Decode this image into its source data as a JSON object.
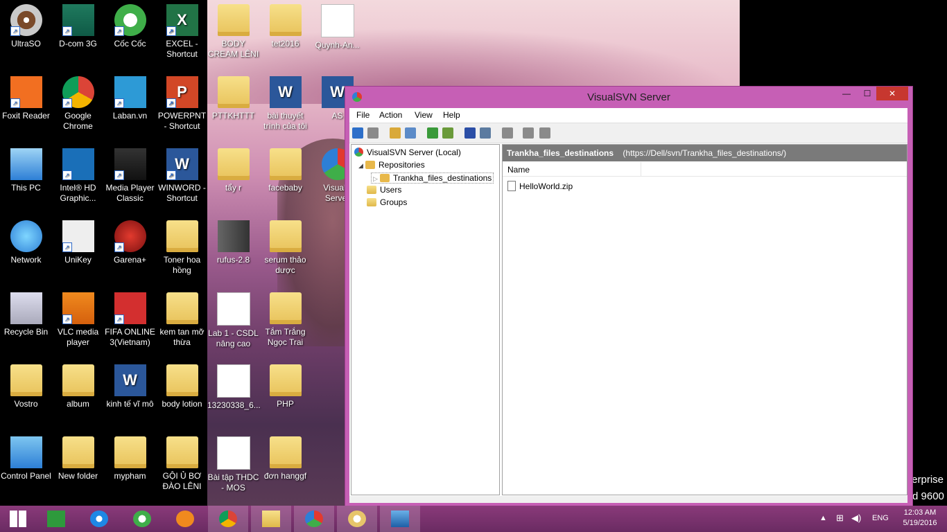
{
  "desktop": {
    "icons": [
      {
        "label": "UltraSO",
        "icon": "ultraiso-icon"
      },
      {
        "label": "D-com 3G",
        "icon": "dcom-3g-icon"
      },
      {
        "label": "Cốc Cốc",
        "icon": "coccoc-icon"
      },
      {
        "label": "EXCEL - Shortcut",
        "icon": "excel-icon"
      },
      {
        "label": "Foxit Reader",
        "icon": "foxit-reader-icon"
      },
      {
        "label": "Google Chrome",
        "icon": "chrome-icon"
      },
      {
        "label": "Laban.vn",
        "icon": "laban-icon"
      },
      {
        "label": "POWERPNT - Shortcut",
        "icon": "powerpoint-icon"
      },
      {
        "label": "This PC",
        "icon": "this-pc-icon"
      },
      {
        "label": "Intel® HD Graphic...",
        "icon": "intel-hd-icon"
      },
      {
        "label": "Media Player Classic",
        "icon": "media-player-classic-icon"
      },
      {
        "label": "WINWORD - Shortcut",
        "icon": "word-icon"
      },
      {
        "label": "Network",
        "icon": "network-icon"
      },
      {
        "label": "UniKey",
        "icon": "unikey-icon"
      },
      {
        "label": "Garena+",
        "icon": "garena-icon"
      },
      {
        "label": "Toner hoa hồng",
        "icon": "folder-icon"
      },
      {
        "label": "Recycle Bin",
        "icon": "recycle-bin-icon"
      },
      {
        "label": "VLC media player",
        "icon": "vlc-icon"
      },
      {
        "label": "FIFA ONLINE 3(Vietnam)",
        "icon": "fifa-online-icon"
      },
      {
        "label": "kem tan mỡ thừa",
        "icon": "folder-icon"
      },
      {
        "label": "Vostro",
        "icon": "user-folder-icon"
      },
      {
        "label": "album",
        "icon": "folder-icon"
      },
      {
        "label": "kinh tế vĩ mô",
        "icon": "word-doc-icon"
      },
      {
        "label": "body lotion",
        "icon": "folder-icon"
      },
      {
        "label": "Control Panel",
        "icon": "control-panel-icon"
      },
      {
        "label": "New folder",
        "icon": "folder-icon"
      },
      {
        "label": "mypham",
        "icon": "folder-icon"
      },
      {
        "label": "GỘI Ủ BƠ ĐÀO LÊNI",
        "icon": "folder-icon"
      },
      {
        "label": "BODY CREAM LÊNI",
        "icon": "folder-icon"
      },
      {
        "label": "tet2016",
        "icon": "folder-icon"
      },
      {
        "label": "Quynh-An...",
        "icon": "photo-icon"
      },
      {
        "label": "PTTKHTTT",
        "icon": "folder-icon"
      },
      {
        "label": "bài thuyết trình của tôi",
        "icon": "word-doc-icon"
      },
      {
        "label": "AS",
        "icon": "word-doc-icon"
      },
      {
        "label": "tẩy r",
        "icon": "folder-icon"
      },
      {
        "label": "facebaby",
        "icon": "folder-icon"
      },
      {
        "label": "VisualS Server",
        "icon": "visualsvn-icon"
      },
      {
        "label": "rufus-2.8",
        "icon": "rufus-icon"
      },
      {
        "label": "serum thảo dược",
        "icon": "folder-icon"
      },
      {
        "label": "Lab 1 - CSDL nâng cao",
        "icon": "document-icon"
      },
      {
        "label": "Tắm Trắng Ngọc Trai",
        "icon": "folder-icon"
      },
      {
        "label": "13230338_6...",
        "icon": "photo-icon"
      },
      {
        "label": "PHP",
        "icon": "folder-icon"
      },
      {
        "label": "Bài tập THDC - MOS",
        "icon": "document-icon"
      },
      {
        "label": "đơn hanggf",
        "icon": "folder-icon"
      }
    ],
    "bg_text_1": "terprise",
    "bg_text_2": "d 9600"
  },
  "window": {
    "title": "VisualSVN Server",
    "controls": {
      "minimize": "—",
      "maximize": "☐",
      "close": "✕"
    },
    "menu": [
      "File",
      "Action",
      "View",
      "Help"
    ],
    "toolbar": [
      {
        "icon": "back-arrow-icon",
        "color": "#2d6fc9"
      },
      {
        "icon": "forward-arrow-icon",
        "color": "#8a8a8a"
      },
      {
        "icon": "up-folder-icon",
        "color": "#d9a93a"
      },
      {
        "icon": "show-tree-icon",
        "color": "#5c8bc8"
      },
      {
        "icon": "refresh-icon",
        "color": "#3a9a3a"
      },
      {
        "icon": "export-icon",
        "color": "#6a9a3a"
      },
      {
        "icon": "help-icon",
        "color": "#2b4ea6"
      },
      {
        "icon": "properties-icon",
        "color": "#5c7ba0"
      },
      {
        "icon": "new-item-icon",
        "color": "#8a8a8a"
      },
      {
        "icon": "command-icon",
        "color": "#8a8a8a"
      },
      {
        "icon": "settings-icon",
        "color": "#8a8a8a"
      }
    ],
    "tree": {
      "root": "VisualSVN Server (Local)",
      "repositories": "Repositories",
      "repo_item": "Trankha_files_destinations",
      "users": "Users",
      "groups": "Groups"
    },
    "content": {
      "repo_name": "Trankha_files_destinations",
      "repo_url": "(https://Dell/svn/Trankha_files_destinations/)",
      "column_name": "Name",
      "files": [
        "HelloWorld.zip"
      ]
    }
  },
  "taskbar": {
    "items": [
      {
        "icon": "start-icon"
      },
      {
        "icon": "store-icon"
      },
      {
        "icon": "internet-explorer-icon"
      },
      {
        "icon": "coccoc-icon"
      },
      {
        "icon": "media-player-icon"
      },
      {
        "icon": "chrome-icon"
      },
      {
        "icon": "file-explorer-icon"
      },
      {
        "icon": "visualsvn-icon"
      },
      {
        "icon": "paint-icon"
      },
      {
        "icon": "photo-viewer-icon"
      }
    ],
    "language": "ENG",
    "time": "12:03 AM",
    "date": "5/19/2016"
  }
}
